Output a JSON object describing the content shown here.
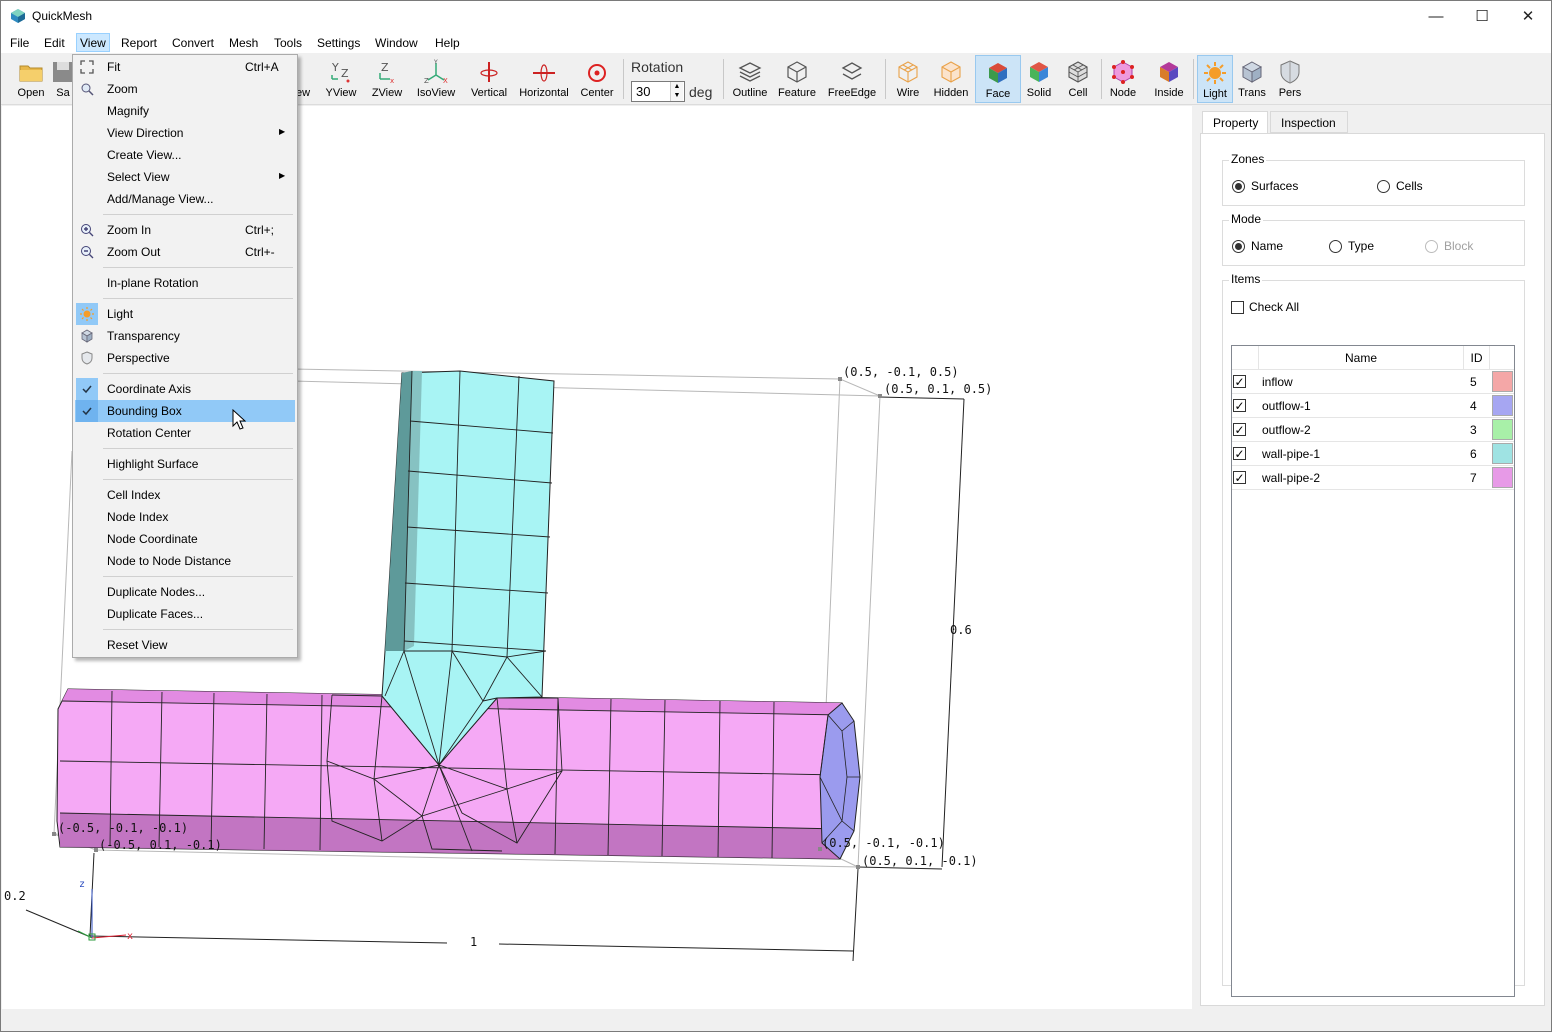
{
  "window": {
    "title": "QuickMesh",
    "controls": [
      "—",
      "☐",
      "✕"
    ]
  },
  "menubar": [
    "File",
    "Edit",
    "View",
    "Report",
    "Convert",
    "Mesh",
    "Tools",
    "Settings",
    "Window",
    "Help"
  ],
  "toolbar": {
    "open": "Open",
    "save": "Sa",
    "xview_partial": "ew",
    "yview": "YView",
    "zview": "ZView",
    "isoview": "IsoView",
    "vertical": "Vertical",
    "horizontal": "Horizontal",
    "center": "Center",
    "rotation_label": "Rotation",
    "rotation_value": "30",
    "rotation_unit": "deg",
    "outline": "Outline",
    "feature": "Feature",
    "freeedge": "FreeEdge",
    "wire": "Wire",
    "hidden": "Hidden",
    "face": "Face",
    "solid": "Solid",
    "cell": "Cell",
    "node": "Node",
    "inside": "Inside",
    "light": "Light",
    "trans": "Trans",
    "pers": "Pers"
  },
  "view_menu": {
    "fit": "Fit",
    "fit_shortcut": "Ctrl+A",
    "zoom": "Zoom",
    "magnify": "Magnify",
    "view_direction": "View Direction",
    "create_view": "Create View...",
    "select_view": "Select View",
    "add_manage_view": "Add/Manage View...",
    "zoom_in": "Zoom In",
    "zoom_in_shortcut": "Ctrl+;",
    "zoom_out": "Zoom Out",
    "zoom_out_shortcut": "Ctrl+-",
    "inplane_rotation": "In-plane Rotation",
    "light": "Light",
    "transparency": "Transparency",
    "perspective": "Perspective",
    "coordinate_axis": "Coordinate Axis",
    "bounding_box": "Bounding Box",
    "rotation_center": "Rotation Center",
    "highlight_surface": "Highlight Surface",
    "cell_index": "Cell Index",
    "node_index": "Node Index",
    "node_coordinate": "Node Coordinate",
    "node_distance": "Node to Node Distance",
    "duplicate_nodes": "Duplicate Nodes...",
    "duplicate_faces": "Duplicate Faces...",
    "reset_view": "Reset View"
  },
  "viewport": {
    "labels": {
      "top_left_back": "(0.5, -0.1, 0.5)",
      "top_right_front": "(0.5, 0.1, 0.5)",
      "bottom_left_back": "(-0.5, -0.1, -0.1)",
      "bottom_left_front": "(-0.5, 0.1, -0.1)",
      "bottom_right_back": "(0.5, -0.1, -0.1)",
      "bottom_right_front": "(0.5, 0.1, -0.1)",
      "dim_height": "0.6",
      "dim_length": "1",
      "dim_depth": "0.2",
      "axis_z": "z",
      "axis_x": "x"
    }
  },
  "panel": {
    "tabs": [
      "Property",
      "Inspection"
    ],
    "zones_title": "Zones",
    "zones_surfaces": "Surfaces",
    "zones_cells": "Cells",
    "mode_title": "Mode",
    "mode_name": "Name",
    "mode_type": "Type",
    "mode_block": "Block",
    "items_title": "Items",
    "check_all": "Check All",
    "col_name": "Name",
    "col_id": "ID",
    "rows": [
      {
        "name": "inflow",
        "id": "5",
        "color": "#f4a7a7"
      },
      {
        "name": "outflow-1",
        "id": "4",
        "color": "#a6a6f2"
      },
      {
        "name": "outflow-2",
        "id": "3",
        "color": "#a8f0a8"
      },
      {
        "name": "wall-pipe-1",
        "id": "6",
        "color": "#9fe3e3"
      },
      {
        "name": "wall-pipe-2",
        "id": "7",
        "color": "#e79ae7"
      }
    ]
  },
  "colors": {
    "pipe_pink": "#f5a9f5",
    "pipe_cyan": "#a8f4f4",
    "outlet_blue": "#9b9bee",
    "menu_highlight": "#91c9f7"
  }
}
